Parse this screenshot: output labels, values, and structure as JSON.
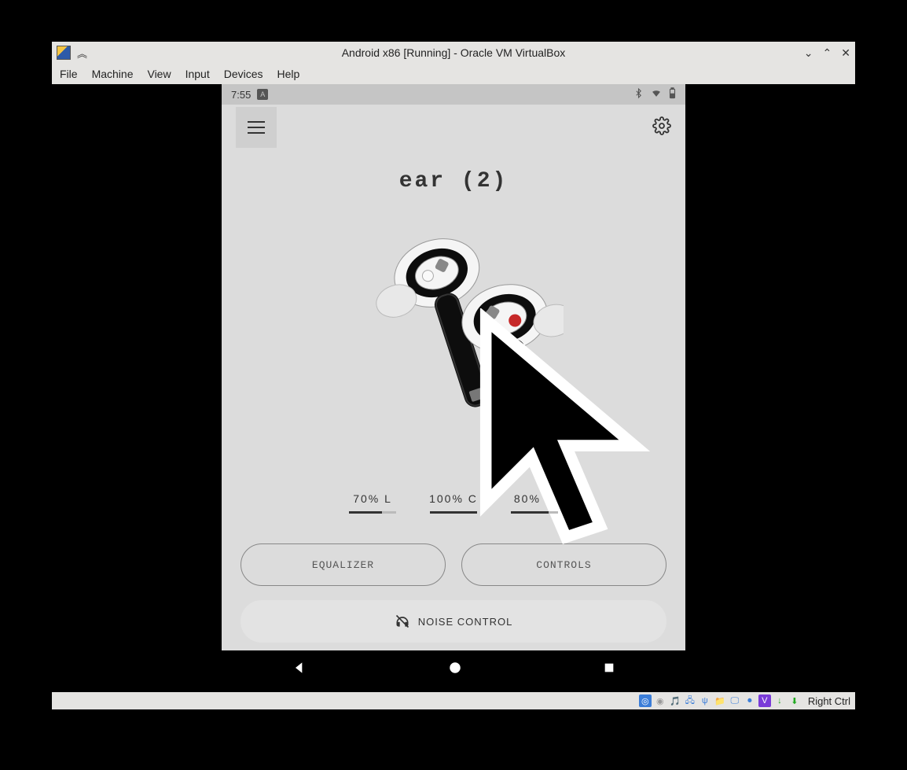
{
  "vb": {
    "title": "Android x86 [Running] - Oracle VM VirtualBox",
    "menu": {
      "file": "File",
      "machine": "Machine",
      "view": "View",
      "input": "Input",
      "devices": "Devices",
      "help": "Help"
    },
    "hostkey": "Right Ctrl"
  },
  "android": {
    "status_time": "7:55",
    "status_badge": "A",
    "app": {
      "product_name": "ear (2)",
      "battery": {
        "left_pct": 70,
        "left_label": "70% L",
        "case_pct": 100,
        "case_label": "100% C",
        "right_pct": 80,
        "right_label": "80% R"
      },
      "buttons": {
        "equalizer": "EQUALIZER",
        "controls": "CONTROLS",
        "noise_control": "NOISE CONTROL"
      }
    }
  },
  "icons": {
    "hamburger": "menu-icon",
    "gear": "gear-icon",
    "bluetooth": "bluetooth-icon",
    "wifi": "wifi-icon",
    "batt": "battery-icon",
    "minimize": "minimize-icon",
    "maximize": "maximize-icon",
    "close": "close-icon",
    "expand": "expand-icon",
    "nav_back": "nav-back-icon",
    "nav_home": "nav-home-icon",
    "nav_recent": "nav-recent-icon",
    "noise": "noise-off-icon"
  }
}
